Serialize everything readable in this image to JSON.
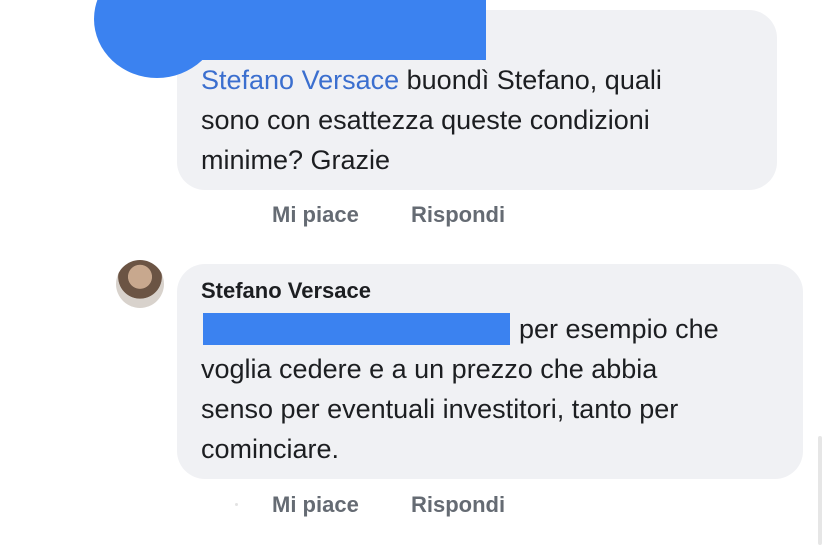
{
  "comment_1": {
    "mention": "Stefano Versace",
    "line_1_rest": " buondì Stefano, quali",
    "line_2": "sono con esattezza queste condizioni",
    "line_3": "minime? Grazie",
    "actions": {
      "like": "Mi piace",
      "reply": "Rispondi"
    }
  },
  "comment_2": {
    "author": "Stefano Versace",
    "line_1_rest": "per esempio che",
    "line_2": "voglia cedere e a un prezzo che abbia",
    "line_3": "senso per eventuali investitori, tanto per",
    "line_4": "cominciare.",
    "actions": {
      "like": "Mi piace",
      "reply": "Rispondi"
    }
  },
  "colors": {
    "redaction": "#3b82f0",
    "bubble": "#f0f1f4",
    "mention": "#3b6fcf",
    "action_text": "#656b73"
  }
}
